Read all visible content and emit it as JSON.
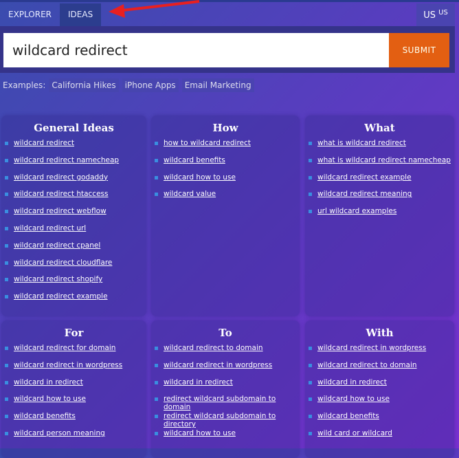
{
  "tabs": [
    "EXPLORER",
    "IDEAS"
  ],
  "lang": {
    "main": "US",
    "sub": "US"
  },
  "search": {
    "value": "wildcard redirect",
    "submit": "SUBMIT"
  },
  "examples": {
    "label": "Examples:",
    "items": [
      "California Hikes",
      "iPhone Apps",
      "Email Marketing"
    ]
  },
  "cards": [
    {
      "title": "General Ideas",
      "items": [
        "wildcard redirect",
        "wildcard redirect namecheap",
        "wildcard redirect godaddy",
        "wildcard redirect htaccess",
        "wildcard redirect webflow",
        "wildcard redirect url",
        "wildcard redirect cpanel",
        "wildcard redirect cloudflare",
        "wildcard redirect shopify",
        "wildcard redirect example"
      ]
    },
    {
      "title": "How",
      "items": [
        "how to wildcard redirect",
        "wildcard benefits",
        "wildcard how to use",
        "wildcard value"
      ]
    },
    {
      "title": "What",
      "items": [
        "what is wildcard redirect",
        "what is wildcard redirect namecheap",
        "wildcard redirect example",
        "wildcard redirect meaning",
        "url wildcard examples"
      ]
    },
    {
      "title": "For",
      "items": [
        "wildcard redirect for domain",
        "wildcard redirect in wordpress",
        "wildcard in redirect",
        "wildcard how to use",
        "wildcard benefits",
        "wildcard person meaning"
      ]
    },
    {
      "title": "To",
      "items": [
        "wildcard redirect to domain",
        "wildcard redirect in wordpress",
        "wildcard in redirect",
        "redirect wildcard subdomain to domain",
        "redirect wildcard subdomain to directory",
        "wildcard how to use"
      ]
    },
    {
      "title": "With",
      "items": [
        "wildcard redirect in wordpress",
        "wildcard redirect to domain",
        "wildcard in redirect",
        "wildcard how to use",
        "wildcard benefits",
        "wild card or wildcard"
      ]
    }
  ]
}
